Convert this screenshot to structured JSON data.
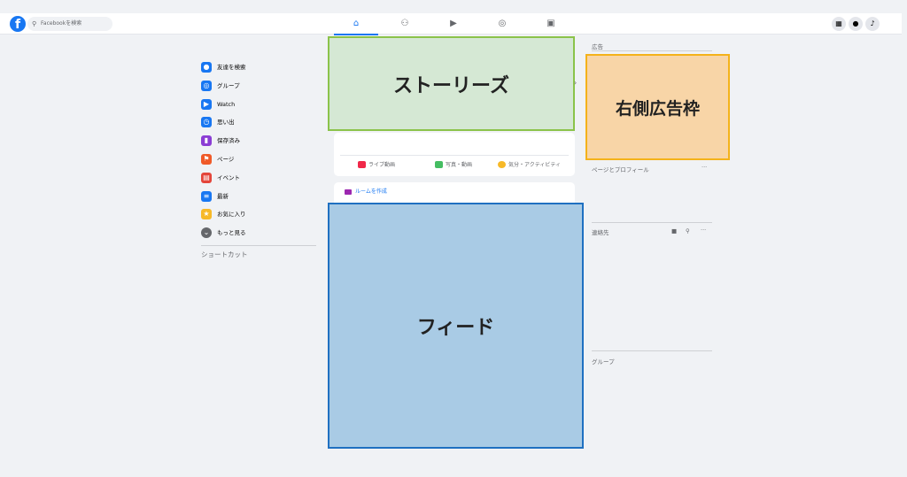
{
  "header": {
    "search_placeholder": "Facebookを検索",
    "nav_tabs": [
      {
        "icon": "home-icon",
        "glyph": "⌂"
      },
      {
        "icon": "friends-icon",
        "glyph": "⚇"
      },
      {
        "icon": "watch-icon",
        "glyph": "▶"
      },
      {
        "icon": "groups-icon",
        "glyph": "◎"
      },
      {
        "icon": "gaming-icon",
        "glyph": "▣"
      }
    ],
    "right_buttons": [
      {
        "icon": "menu-grid-icon",
        "glyph": "▦"
      },
      {
        "icon": "messenger-icon",
        "glyph": "●"
      },
      {
        "icon": "notifications-icon",
        "glyph": "♪"
      }
    ]
  },
  "sidebar": {
    "items": [
      {
        "label": "友達を検索",
        "icon": "friends-icon",
        "color": "#1877f2",
        "glyph": "●"
      },
      {
        "label": "グループ",
        "icon": "groups-icon",
        "color": "#1877f2",
        "glyph": "◎"
      },
      {
        "label": "Watch",
        "icon": "watch-icon",
        "color": "#1877f2",
        "glyph": "▶"
      },
      {
        "label": "思い出",
        "icon": "memories-icon",
        "color": "#1877f2",
        "glyph": "◷"
      },
      {
        "label": "保存済み",
        "icon": "saved-icon",
        "color": "#8b3dd4",
        "glyph": "▮"
      },
      {
        "label": "ページ",
        "icon": "pages-icon",
        "color": "#f05a28",
        "glyph": "⚑"
      },
      {
        "label": "イベント",
        "icon": "events-icon",
        "color": "#e4453a",
        "glyph": "▤"
      },
      {
        "label": "最新",
        "icon": "latest-icon",
        "color": "#1877f2",
        "glyph": "≡"
      },
      {
        "label": "お気に入り",
        "icon": "favorites-icon",
        "color": "#f7b928",
        "glyph": "★"
      },
      {
        "label": "もっと見る",
        "icon": "chevron-down-icon",
        "color": "#65676b",
        "glyph": "⌄"
      }
    ],
    "shortcuts_title": "ショートカット"
  },
  "stories": {
    "label": "ストーリーズ"
  },
  "composer": {
    "actions": [
      {
        "label": "ライブ動画",
        "icon": "live-video-icon",
        "color": "#f02849"
      },
      {
        "label": "写真・動画",
        "icon": "photo-video-icon",
        "color": "#45bd62"
      },
      {
        "label": "気分・アクティビティ",
        "icon": "feeling-icon",
        "color": "#f7b928"
      }
    ]
  },
  "room": {
    "label": "ルームを作成"
  },
  "feed": {
    "label": "フィード"
  },
  "right": {
    "ads_title": "広告",
    "ad_box_label": "右側広告枠",
    "pages_title": "ページとプロフィール",
    "contacts_title": "連絡先",
    "groups_title": "グループ"
  }
}
